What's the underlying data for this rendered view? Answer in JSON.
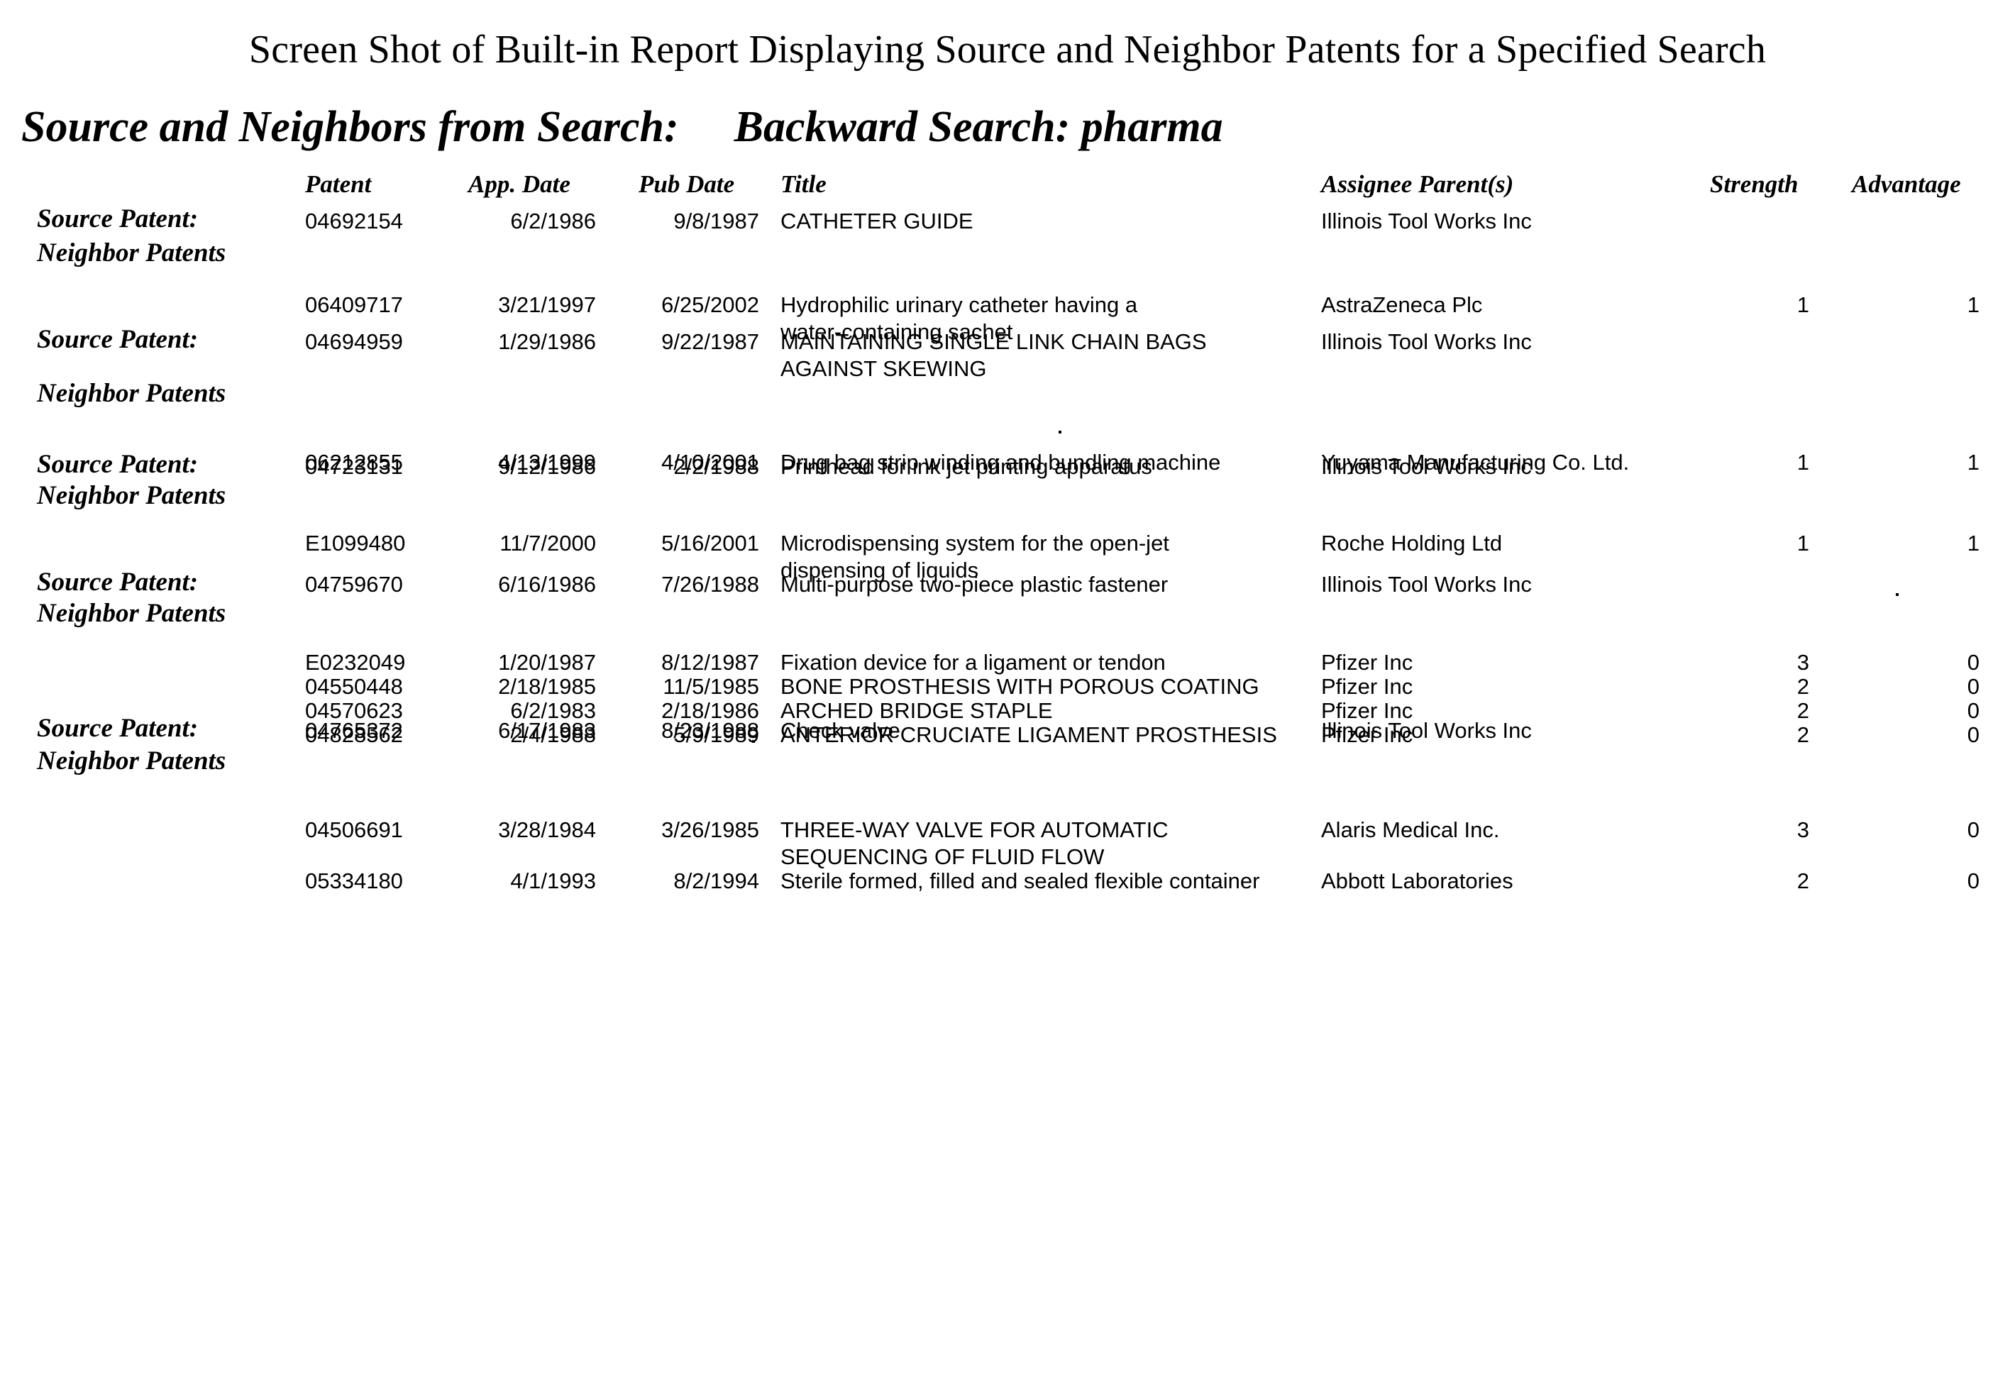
{
  "figure": {
    "caption": "Screen Shot of Built-in Report Displaying Source and Neighbor Patents for a Specified Search"
  },
  "report": {
    "heading_label": "Source and Neighbors from Search:",
    "heading_value": "Backward Search: pharma",
    "row_labels": {
      "source": "Source Patent:",
      "neighbors": "Neighbor Patents"
    },
    "columns": {
      "patent": "Patent",
      "app_date": "App. Date",
      "pub_date": "Pub Date",
      "title": "Title",
      "assignee": "Assignee Parent(s)",
      "strength": "Strength",
      "advantage": "Advantage"
    },
    "groups": [
      {
        "source": {
          "patent": "04692154",
          "app_date": "6/2/1986",
          "pub_date": "9/8/1987",
          "title": "CATHETER GUIDE",
          "title_line2": "",
          "assignee": "Illinois Tool Works Inc",
          "strength": "",
          "advantage": ""
        },
        "neighbors": [
          {
            "patent": "06409717",
            "app_date": "3/21/1997",
            "pub_date": "6/25/2002",
            "title": "Hydrophilic urinary catheter having a",
            "title_line2": "water-containing sachet",
            "assignee": "AstraZeneca Plc",
            "strength": "1",
            "advantage": "1"
          }
        ]
      },
      {
        "source": {
          "patent": "04694959",
          "app_date": "1/29/1986",
          "pub_date": "9/22/1987",
          "title": "MAINTAINING SINGLE LINK CHAIN BAGS",
          "title_line2": "AGAINST SKEWING",
          "assignee": "Illinois Tool Works Inc",
          "strength": "",
          "advantage": ""
        },
        "neighbors": [
          {
            "patent": "06212855",
            "app_date": "4/13/1999",
            "pub_date": "4/10/2001",
            "title": "Drug bag strip winding and bundling machine",
            "title_line2": "",
            "assignee": "Yuyama Manufacturing Co. Ltd.",
            "strength": "1",
            "advantage": "1"
          }
        ]
      },
      {
        "source": {
          "patent": "04723131",
          "app_date": "9/12/1986",
          "pub_date": "2/2/1988",
          "title": "Printhead for ink jet printing apparatus",
          "title_line2": "",
          "assignee": "Illinois Tool Works Inc",
          "strength": "",
          "advantage": ""
        },
        "neighbors": [
          {
            "patent": "E1099480",
            "app_date": "11/7/2000",
            "pub_date": "5/16/2001",
            "title": "Microdispensing system for the open-jet",
            "title_line2": "dispensing of liquids",
            "assignee": "Roche Holding Ltd",
            "strength": "1",
            "advantage": "1"
          }
        ]
      },
      {
        "source": {
          "patent": "04759670",
          "app_date": "6/16/1986",
          "pub_date": "7/26/1988",
          "title": "Multi-purpose two-piece plastic fastener",
          "title_line2": "",
          "assignee": "Illinois Tool Works Inc",
          "strength": "",
          "advantage": ""
        },
        "neighbors": [
          {
            "patent": "E0232049",
            "app_date": "1/20/1987",
            "pub_date": "8/12/1987",
            "title": "Fixation device for a ligament or tendon",
            "title_line2": "",
            "assignee": "Pfizer Inc",
            "strength": "3",
            "advantage": "0"
          },
          {
            "patent": "04550448",
            "app_date": "2/18/1985",
            "pub_date": "11/5/1985",
            "title": "BONE PROSTHESIS WITH POROUS COATING",
            "title_line2": "",
            "assignee": "Pfizer Inc",
            "strength": "2",
            "advantage": "0"
          },
          {
            "patent": "04570623",
            "app_date": "6/2/1983",
            "pub_date": "2/18/1986",
            "title": "ARCHED BRIDGE STAPLE",
            "title_line2": "",
            "assignee": "Pfizer Inc",
            "strength": "2",
            "advantage": "0"
          },
          {
            "patent": "04828562",
            "app_date": "2/4/1988",
            "pub_date": "5/9/1989",
            "title": "ANTERIOR CRUCIATE LIGAMENT PROSTHESIS",
            "title_line2": "",
            "assignee": "Pfizer Inc",
            "strength": "2",
            "advantage": "0"
          }
        ]
      },
      {
        "source": {
          "patent": "04765372",
          "app_date": "6/17/1983",
          "pub_date": "8/23/1988",
          "title": "Check valve",
          "title_line2": "",
          "assignee": "Illinois Tool Works Inc",
          "strength": "",
          "advantage": ""
        },
        "neighbors": [
          {
            "patent": "04506691",
            "app_date": "3/28/1984",
            "pub_date": "3/26/1985",
            "title": "THREE-WAY VALVE FOR AUTOMATIC",
            "title_line2": "SEQUENCING OF FLUID FLOW",
            "assignee": "Alaris Medical Inc.",
            "strength": "3",
            "advantage": "0"
          },
          {
            "patent": "05334180",
            "app_date": "4/1/1993",
            "pub_date": "8/2/1994",
            "title": "Sterile formed, filled and sealed flexible container",
            "title_line2": "",
            "assignee": "Abbott Laboratories",
            "strength": "2",
            "advantage": "0"
          }
        ]
      }
    ]
  }
}
